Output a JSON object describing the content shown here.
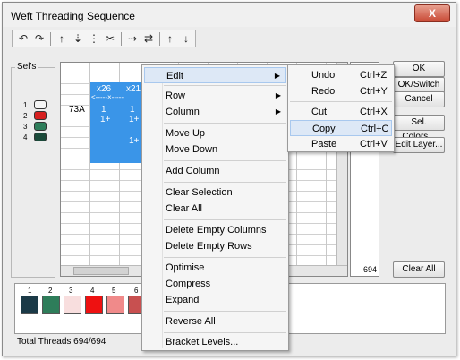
{
  "window": {
    "title": "Weft Threading Sequence",
    "close_label": "X"
  },
  "toolbar": {
    "icons": [
      "undo-icon",
      "redo-icon",
      "insert-thread-icon",
      "thread-icon",
      "thread-alt-icon",
      "cut-thread-icon",
      "swap-icon",
      "swap-alt-icon",
      "up-arrow-icon",
      "down-arrow-icon"
    ],
    "glyphs": [
      "↶",
      "↷",
      "↑",
      "⇣",
      "⋮",
      "✂",
      "⇢",
      "⇄",
      "↑",
      "↓"
    ]
  },
  "sels": {
    "label": "Sel's",
    "spools": [
      {
        "num": "1",
        "color": "#f5f5f5"
      },
      {
        "num": "2",
        "color": "#d62020"
      },
      {
        "num": "3",
        "color": "#2e7d5a"
      },
      {
        "num": "4",
        "color": "#1b4a3a"
      }
    ]
  },
  "grid": {
    "cell_label": "73A",
    "col_headers": [
      "x26",
      "x21"
    ],
    "values": [
      "1",
      "1",
      "1+",
      "1+",
      "1+"
    ],
    "side_count": "694"
  },
  "buttons": {
    "ok": "OK",
    "ok_switch": "OK/Switch",
    "cancel": "Cancel",
    "sel_colors": "Sel. Colors...",
    "edit_layer": "Edit Layer...",
    "clear_all": "Clear All"
  },
  "palette": {
    "swatches": [
      {
        "num": "1",
        "color": "#1b3a47"
      },
      {
        "num": "2",
        "color": "#2e7d5a"
      },
      {
        "num": "3",
        "color": "#f8dede"
      },
      {
        "num": "4",
        "color": "#ee1111"
      },
      {
        "num": "5",
        "color": "#f08a8a"
      },
      {
        "num": "6",
        "color": "#c85050"
      }
    ]
  },
  "status": {
    "total_threads": "Total Threads 694/694"
  },
  "context_menu": {
    "edit": "Edit",
    "row": "Row",
    "column": "Column",
    "move_up": "Move Up",
    "move_down": "Move Down",
    "add_column": "Add Column",
    "clear_selection": "Clear Selection",
    "clear_all": "Clear All",
    "delete_empty_columns": "Delete Empty Columns",
    "delete_empty_rows": "Delete Empty Rows",
    "optimise": "Optimise",
    "compress": "Compress",
    "expand": "Expand",
    "reverse_all": "Reverse All",
    "bracket_levels": "Bracket Levels..."
  },
  "edit_submenu": {
    "undo": {
      "label": "Undo",
      "shortcut": "Ctrl+Z"
    },
    "redo": {
      "label": "Redo",
      "shortcut": "Ctrl+Y"
    },
    "cut": {
      "label": "Cut",
      "shortcut": "Ctrl+X"
    },
    "copy": {
      "label": "Copy",
      "shortcut": "Ctrl+C"
    },
    "paste": {
      "label": "Paste",
      "shortcut": "Ctrl+V"
    }
  }
}
